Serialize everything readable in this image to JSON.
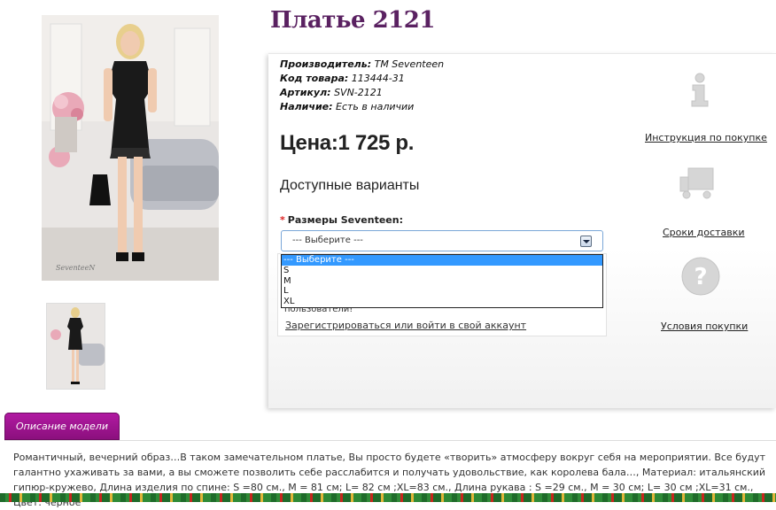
{
  "product": {
    "title": "Платье 2121",
    "manufacturer_label": "Производитель:",
    "manufacturer_value": "TM Seventeen",
    "code_label": "Код товара:",
    "code_value": "113444-31",
    "article_label": "Артикул:",
    "article_value": "SVN-2121",
    "availability_label": "Наличие:",
    "availability_value": "Есть в наличии",
    "price": "Цена:1 725 р.",
    "variants_heading": "Доступные варианты",
    "size_label": "Размеры Seventeen:",
    "photo_watermark": "SeventeeN"
  },
  "size_select": {
    "selected": "--- Выберите ---",
    "options": [
      "--- Выберите ---",
      "S",
      "M",
      "L",
      "XL"
    ]
  },
  "login": {
    "partial_text": "пользователи!",
    "link_label": "Зарегистрироваться или войти в свой аккаунт"
  },
  "sidebar": {
    "items": [
      {
        "label": "Инструкция по покупке",
        "icon": "info-icon"
      },
      {
        "label": "Сроки доставки",
        "icon": "truck-icon"
      },
      {
        "label": "Условия покупки",
        "icon": "question-icon"
      }
    ]
  },
  "tabs": {
    "description_label": "Описание модели"
  },
  "description": {
    "text": "Романтичный, вечерний образ…В таком замечательном платье, Вы просто будете «творить» атмосферу вокруг себя на мероприятии. Все будут галантно ухаживать за вами, а вы сможете позволить себе расслабится и получать удовольствие, как королева бала…, Материал: итальянский гипюр-кружево, Длина изделия по спине: S =80 см., M = 81 см; L= 82 см ;XL=83 см., Длина рукава : S =29 см., M = 30 см; L= 30 см ;XL=31 см., Цвет: черное"
  },
  "colors": {
    "title": "#5a2161",
    "tab": "#a0168f",
    "select_highlight": "#3399ff",
    "required": "#dd2222"
  }
}
